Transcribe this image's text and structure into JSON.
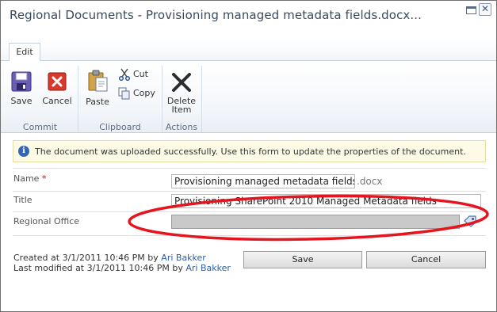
{
  "window": {
    "title": "Regional Documents - Provisioning managed metadata fields.docx..."
  },
  "ribbon": {
    "tab": "Edit",
    "buttons": {
      "save": "Save",
      "cancel": "Cancel",
      "paste": "Paste",
      "cut": "Cut",
      "copy": "Copy",
      "delete_line1": "Delete",
      "delete_line2": "Item"
    },
    "groups": {
      "commit": "Commit",
      "clipboard": "Clipboard",
      "actions": "Actions"
    }
  },
  "info": {
    "message": "The document was uploaded successfully. Use this form to update the properties of the document."
  },
  "form": {
    "name_label": "Name",
    "required_mark": "*",
    "name_value": "Provisioning managed metadata fields",
    "name_extension": ".docx",
    "title_label": "Title",
    "title_value": "Provisioning SharePoint 2010 Managed Metadata fields",
    "regional_office_label": "Regional Office",
    "regional_office_value": ""
  },
  "footer": {
    "created_prefix": "Created at 3/1/2011 10:46 PM by",
    "created_by": "Ari Bakker",
    "modified_prefix": "Last modified at 3/1/2011 10:46 PM by",
    "modified_by": "Ari Bakker",
    "save_button": "Save",
    "cancel_button": "Cancel"
  },
  "colors": {
    "annotation_ellipse": "#e4151f",
    "link": "#2a5ea8",
    "info_bar_bg": "#fdfbe6"
  }
}
